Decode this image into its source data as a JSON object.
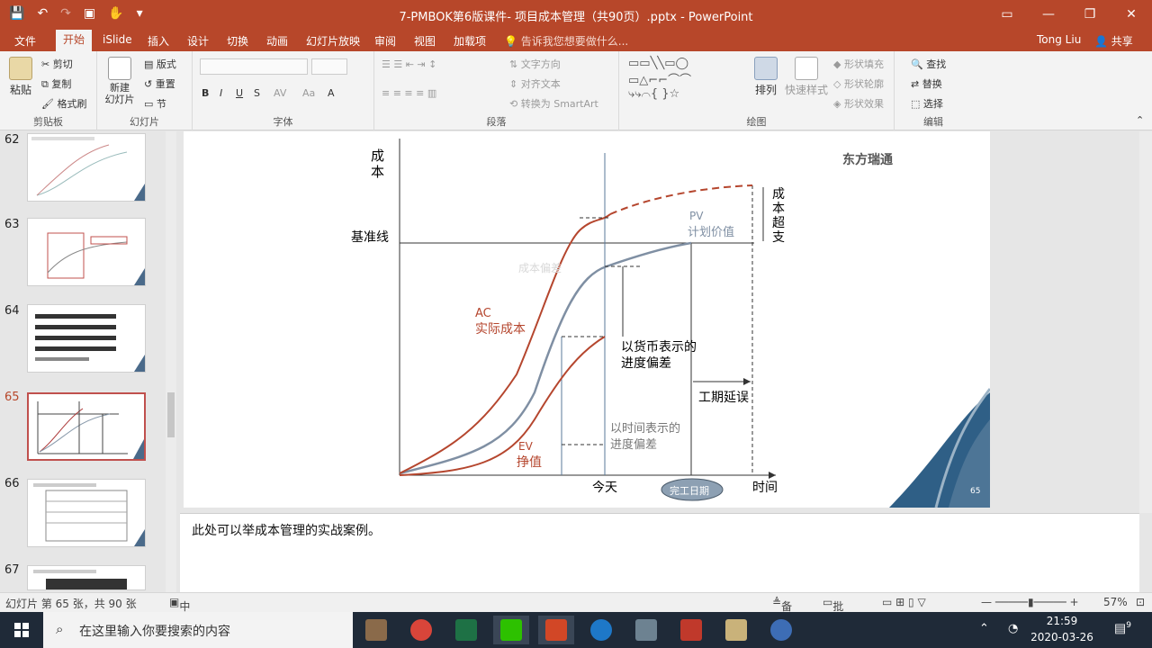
{
  "window": {
    "title": "7-PMBOK第6版课件- 项目成本管理（共90页）.pptx - PowerPoint",
    "user": "Tong Liu",
    "share": "共享"
  },
  "tabs": [
    "文件",
    "开始",
    "iSlide",
    "插入",
    "设计",
    "切换",
    "动画",
    "幻灯片放映",
    "审阅",
    "视图",
    "加载项"
  ],
  "tell_me": "告诉我您想要做什么...",
  "ribbon": {
    "clipboard": {
      "paste": "粘贴",
      "cut": "剪切",
      "copy": "复制",
      "format_painter": "格式刷",
      "label": "剪贴板"
    },
    "slides": {
      "new_slide": "新建\n幻灯片",
      "layout": "版式",
      "reset": "重置",
      "section": "节",
      "label": "幻灯片"
    },
    "font": {
      "label": "字体"
    },
    "paragraph": {
      "text_direction": "文字方向",
      "align_text": "对齐文本",
      "to_smartart": "转换为 SmartArt",
      "label": "段落"
    },
    "drawing": {
      "arrange": "排列",
      "quick_styles": "快速样式",
      "fill": "形状填充",
      "outline": "形状轮廓",
      "effects": "形状效果",
      "label": "绘图"
    },
    "editing": {
      "find": "查找",
      "replace": "替换",
      "select": "选择",
      "label": "编辑"
    }
  },
  "thumbnails": [
    {
      "num": "62",
      "active": false
    },
    {
      "num": "63",
      "active": false
    },
    {
      "num": "64",
      "active": false
    },
    {
      "num": "65",
      "active": true
    },
    {
      "num": "66",
      "active": false
    },
    {
      "num": "67",
      "active": false
    }
  ],
  "slide": {
    "y_axis_label_1": "成",
    "y_axis_label_2": "本",
    "baseline": "基准线",
    "pv": "PV",
    "pv_cn": "计划价值",
    "ac": "AC",
    "ac_cn": "实际成本",
    "ev": "EV",
    "ev_cn": "挣值",
    "cost_label_faint": "成本偏差",
    "cost_overrun": [
      "成",
      "本",
      "超",
      "支"
    ],
    "schedule_money_1": "以货币表示的",
    "schedule_money_2": "进度偏差",
    "schedule_time_1": "以时间表示的",
    "schedule_time_2": "进度偏差",
    "delay": "工期延误",
    "today": "今天",
    "finish": "完工日期",
    "time": "时间",
    "brand": "东方瑞通",
    "page_no": "65"
  },
  "notes": "此处可以举成本管理的实战案例。",
  "status": {
    "slide_info": "幻灯片 第 65 张，共 90 张",
    "language": "中文(中国)",
    "notes_btn": "备注",
    "comments_btn": "批注",
    "zoom": "57%"
  },
  "taskbar": {
    "search_placeholder": "在这里输入你要搜索的内容",
    "time": "21:59",
    "date": "2020-03-26",
    "notification_count": "9"
  }
}
